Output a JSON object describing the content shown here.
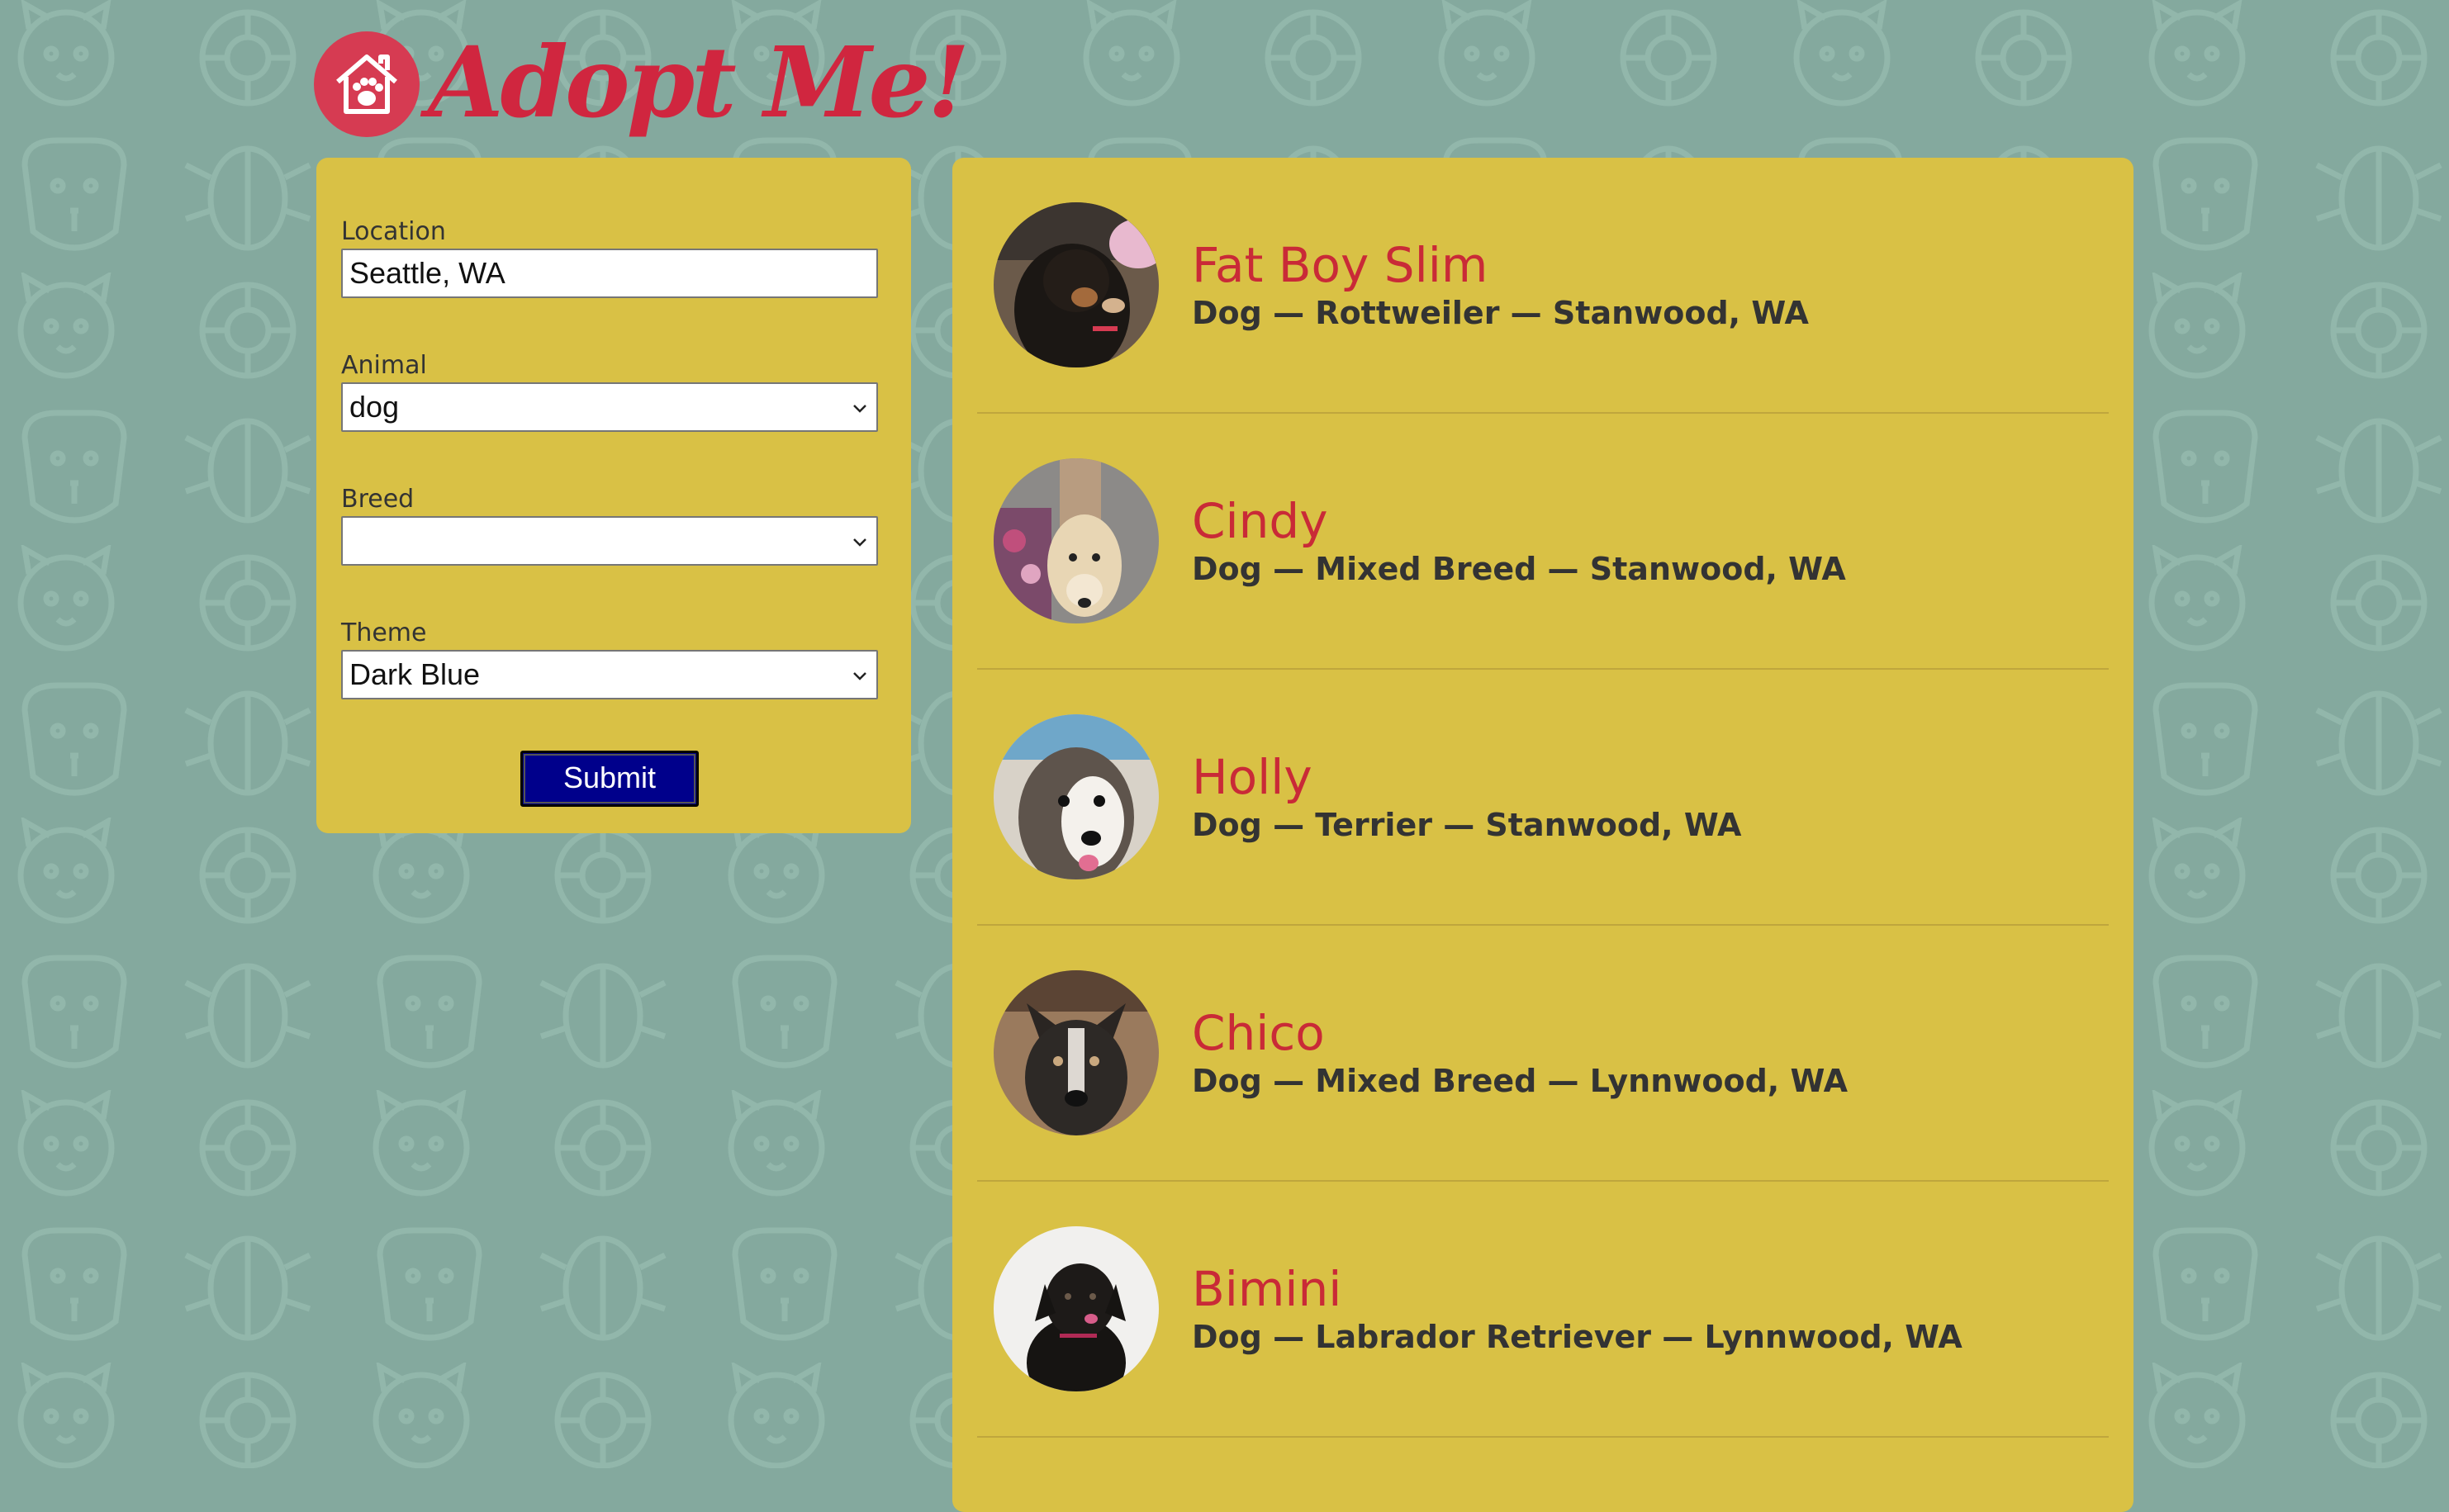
{
  "app": {
    "logo_text": "Adopt Me!"
  },
  "search": {
    "location": {
      "label": "Location",
      "value": "Seattle, WA"
    },
    "animal": {
      "label": "Animal",
      "value": "dog"
    },
    "breed": {
      "label": "Breed",
      "value": ""
    },
    "theme": {
      "label": "Theme",
      "value": "Dark Blue"
    },
    "submit_label": "Submit"
  },
  "pets": [
    {
      "name": "Fat Boy Slim",
      "desc": "Dog — Rottweiler — Stanwood, WA"
    },
    {
      "name": "Cindy",
      "desc": "Dog — Mixed Breed — Stanwood, WA"
    },
    {
      "name": "Holly",
      "desc": "Dog — Terrier — Stanwood, WA"
    },
    {
      "name": "Chico",
      "desc": "Dog — Mixed Breed — Lynnwood, WA"
    },
    {
      "name": "Bimini",
      "desc": "Dog — Labrador Retriever — Lynnwood, WA"
    }
  ],
  "colors": {
    "background": "#84a99e",
    "panel": "#d9c145",
    "accent": "#c92a37",
    "button": "#00008b"
  },
  "icons": [
    "house-paw-icon",
    "chevron-down-icon",
    "pet-pattern-icon"
  ]
}
